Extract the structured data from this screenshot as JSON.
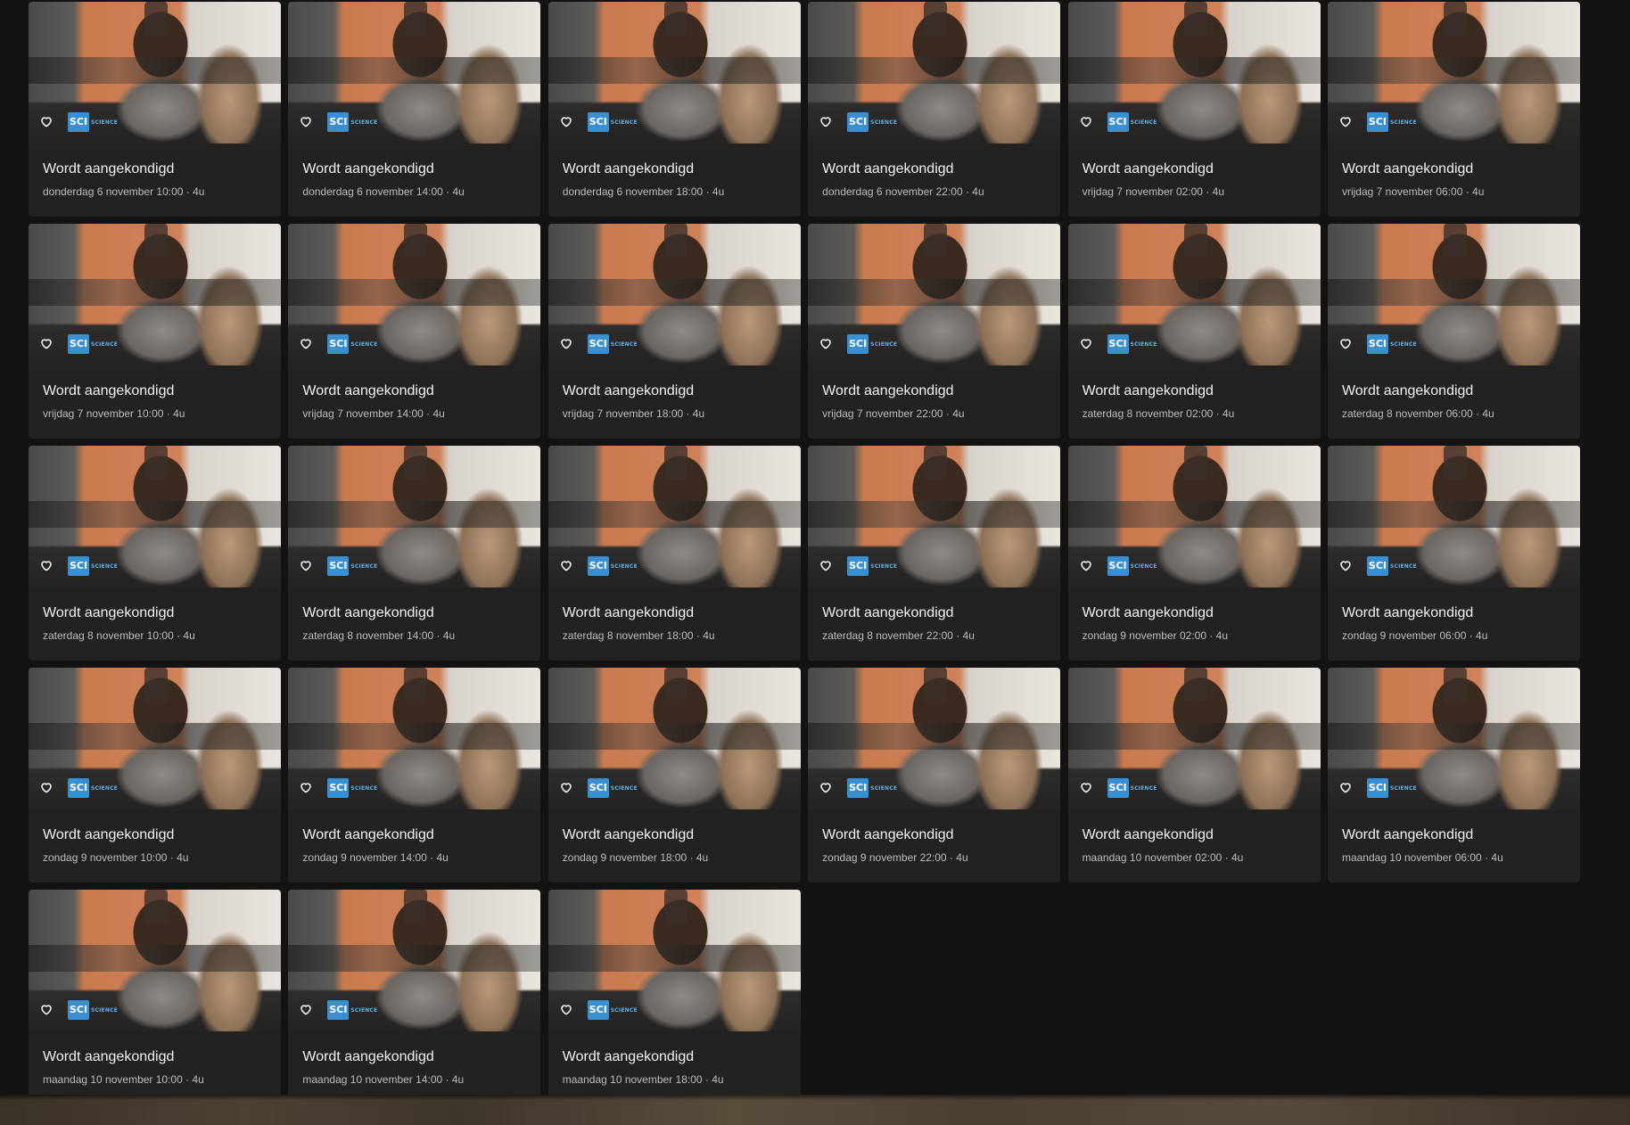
{
  "channel": {
    "logo_text": "SCI",
    "logo_subtext": "SCIENCE",
    "color": "#3a8fd0"
  },
  "cards": [
    {
      "title": "Wordt aangekondigd",
      "meta": "donderdag 6 november 10:00 · 4u"
    },
    {
      "title": "Wordt aangekondigd",
      "meta": "donderdag 6 november 14:00 · 4u"
    },
    {
      "title": "Wordt aangekondigd",
      "meta": "donderdag 6 november 18:00 · 4u"
    },
    {
      "title": "Wordt aangekondigd",
      "meta": "donderdag 6 november 22:00 · 4u"
    },
    {
      "title": "Wordt aangekondigd",
      "meta": "vrijdag 7 november 02:00 · 4u"
    },
    {
      "title": "Wordt aangekondigd",
      "meta": "vrijdag 7 november 06:00 · 4u"
    },
    {
      "title": "Wordt aangekondigd",
      "meta": "vrijdag 7 november 10:00 · 4u"
    },
    {
      "title": "Wordt aangekondigd",
      "meta": "vrijdag 7 november 14:00 · 4u"
    },
    {
      "title": "Wordt aangekondigd",
      "meta": "vrijdag 7 november 18:00 · 4u"
    },
    {
      "title": "Wordt aangekondigd",
      "meta": "vrijdag 7 november 22:00 · 4u"
    },
    {
      "title": "Wordt aangekondigd",
      "meta": "zaterdag 8 november 02:00 · 4u"
    },
    {
      "title": "Wordt aangekondigd",
      "meta": "zaterdag 8 november 06:00 · 4u"
    },
    {
      "title": "Wordt aangekondigd",
      "meta": "zaterdag 8 november 10:00 · 4u"
    },
    {
      "title": "Wordt aangekondigd",
      "meta": "zaterdag 8 november 14:00 · 4u"
    },
    {
      "title": "Wordt aangekondigd",
      "meta": "zaterdag 8 november 18:00 · 4u"
    },
    {
      "title": "Wordt aangekondigd",
      "meta": "zaterdag 8 november 22:00 · 4u"
    },
    {
      "title": "Wordt aangekondigd",
      "meta": "zondag 9 november 02:00 · 4u"
    },
    {
      "title": "Wordt aangekondigd",
      "meta": "zondag 9 november 06:00 · 4u"
    },
    {
      "title": "Wordt aangekondigd",
      "meta": "zondag 9 november 10:00 · 4u"
    },
    {
      "title": "Wordt aangekondigd",
      "meta": "zondag 9 november 14:00 · 4u"
    },
    {
      "title": "Wordt aangekondigd",
      "meta": "zondag 9 november 18:00 · 4u"
    },
    {
      "title": "Wordt aangekondigd",
      "meta": "zondag 9 november 22:00 · 4u"
    },
    {
      "title": "Wordt aangekondigd",
      "meta": "maandag 10 november 02:00 · 4u"
    },
    {
      "title": "Wordt aangekondigd",
      "meta": "maandag 10 november 06:00 · 4u"
    },
    {
      "title": "Wordt aangekondigd",
      "meta": "maandag 10 november 10:00 · 4u"
    },
    {
      "title": "Wordt aangekondigd",
      "meta": "maandag 10 november 14:00 · 4u"
    },
    {
      "title": "Wordt aangekondigd",
      "meta": "maandag 10 november 18:00 · 4u"
    }
  ]
}
